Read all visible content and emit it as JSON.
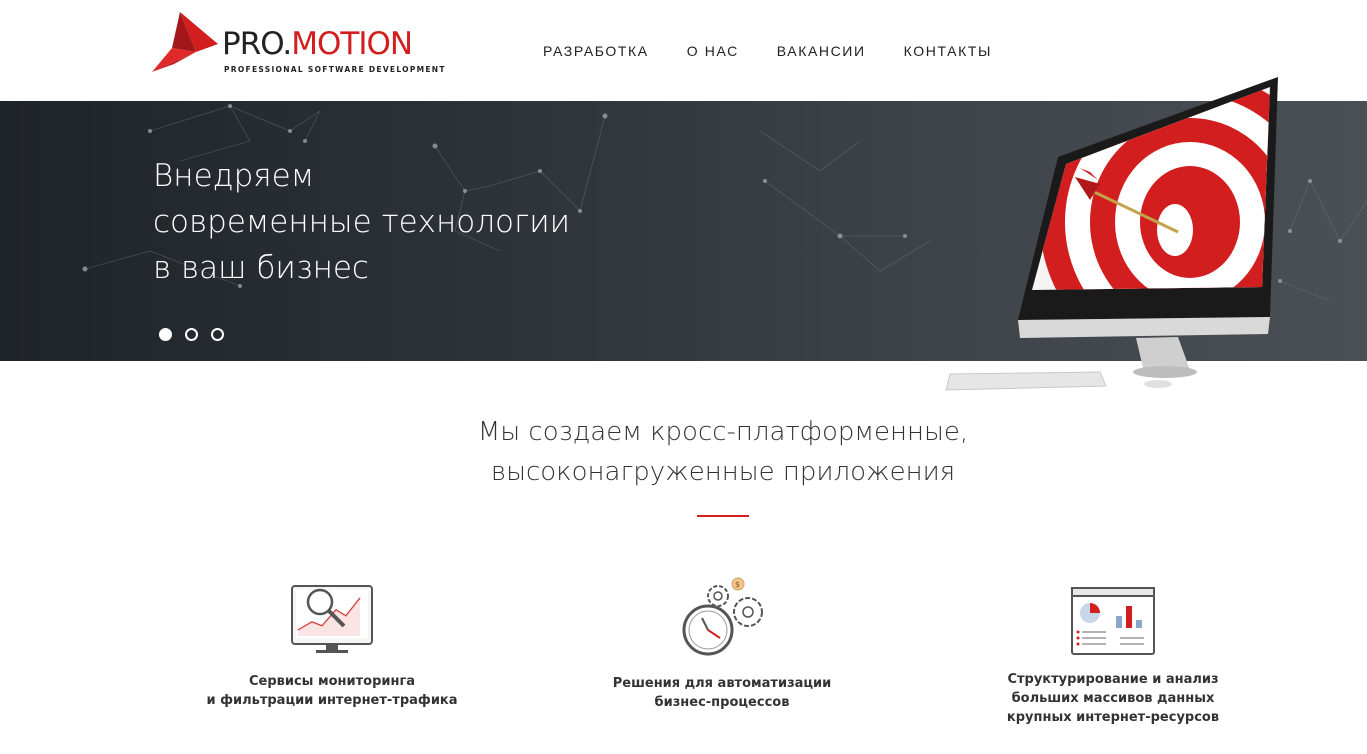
{
  "header": {
    "logo": {
      "pro": "PRO.",
      "motion": "MOTION",
      "subtitle": "PROFESSIONAL SOFTWARE DEVELOPMENT"
    },
    "nav": [
      "РАЗРАБОТКА",
      "О НАС",
      "ВАКАНСИИ",
      "КОНТАКТЫ"
    ]
  },
  "hero": {
    "title_lines": [
      "Внедряем",
      "современные технологии",
      "в ваш бизнес"
    ],
    "slides": 3,
    "active_slide": 1
  },
  "tagline": [
    "Мы создаем кросс-платформенные,",
    "высоконагруженные приложения"
  ],
  "features": [
    {
      "icon": "monitor-magnifier-icon",
      "lines": [
        "Сервисы мониторинга",
        "и фильтрации интернет-трафика"
      ]
    },
    {
      "icon": "gears-clock-icon",
      "lines": [
        "Решения для автоматизации",
        "бизнес-процессов"
      ]
    },
    {
      "icon": "dashboard-charts-icon",
      "lines": [
        "Структурирование и анализ",
        "больших массивов данных",
        "крупных интернет-ресурсов"
      ]
    }
  ],
  "colors": {
    "accent": "#d21e1e",
    "hero_dark": "#1f2429",
    "text": "#333333"
  }
}
